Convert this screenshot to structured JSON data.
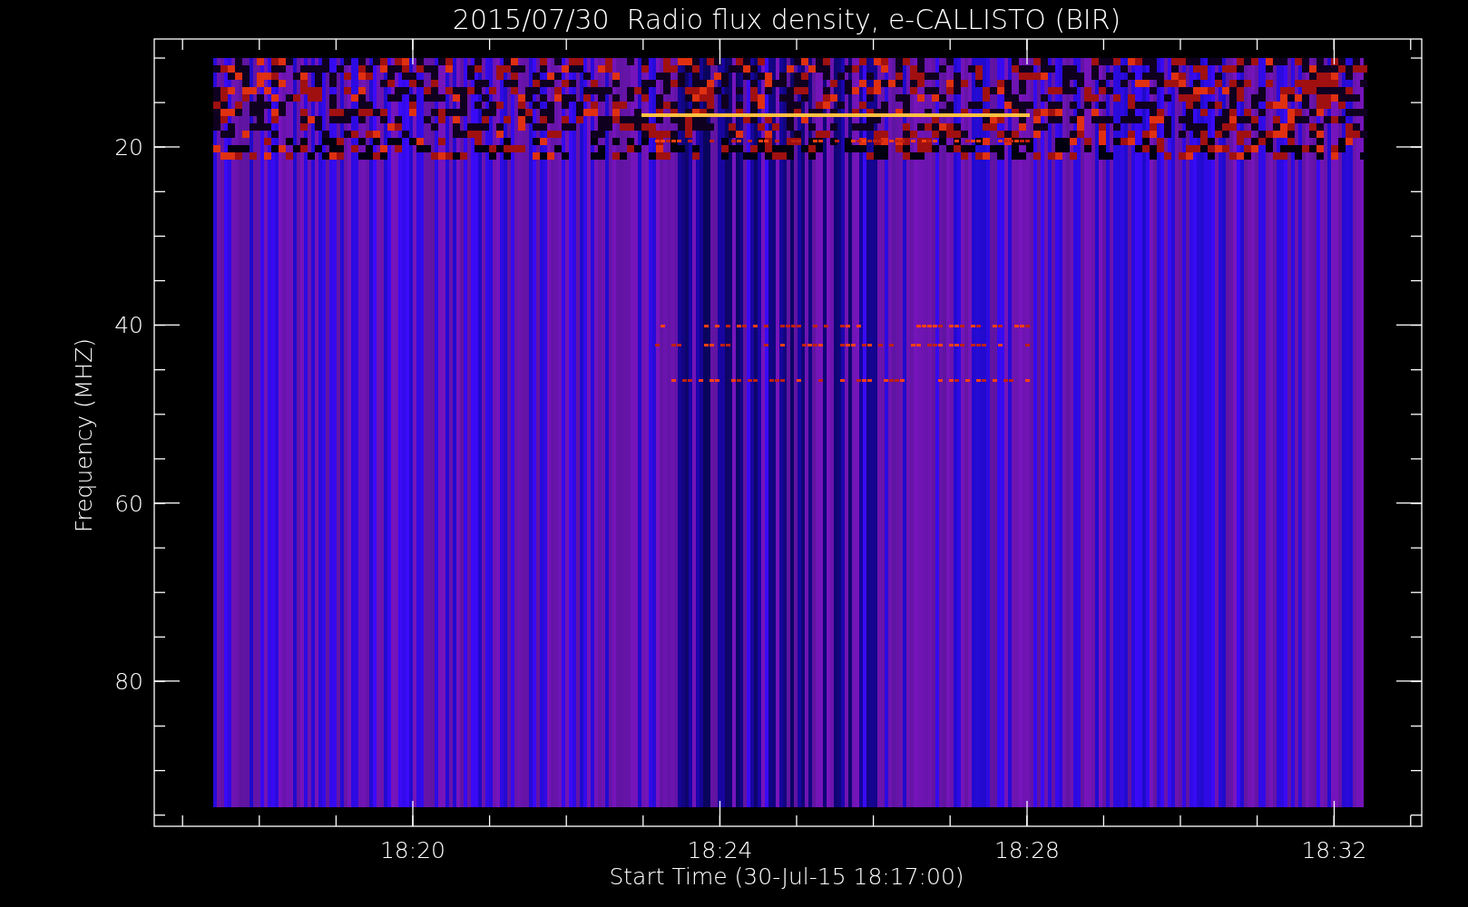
{
  "title": "2015/07/30  Radio flux density, e-CALLISTO (BIR)",
  "y_axis": {
    "label": "Frequency (MHZ)",
    "ticks": [
      "20",
      "40",
      "60",
      "80"
    ]
  },
  "x_axis": {
    "label": "Start Time (30-Jul-15 18:17:00)",
    "ticks": [
      "18:20",
      "18:24",
      "18:28",
      "18:32"
    ]
  }
}
